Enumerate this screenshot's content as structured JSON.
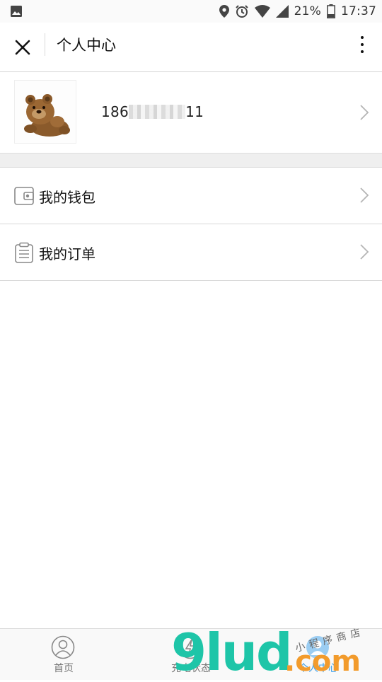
{
  "status_bar": {
    "battery": "21%",
    "time": "17:37",
    "icons": [
      "image-icon",
      "location-icon",
      "alarm-icon",
      "wifi-icon",
      "signal-icon",
      "battery-icon"
    ]
  },
  "header": {
    "title": "个人中心",
    "close_icon": "close-icon",
    "more_icon": "more-vertical-icon"
  },
  "profile": {
    "phone_prefix": "186",
    "phone_suffix": "11",
    "avatar": "teddy-bear-avatar"
  },
  "menu": [
    {
      "label": "我的钱包",
      "icon": "wallet-icon"
    },
    {
      "label": "我的订单",
      "icon": "order-clipboard-icon"
    }
  ],
  "tabbar": [
    {
      "label": "首页",
      "icon": "person-circle-icon"
    },
    {
      "label": "充电状态",
      "icon": "bolt-circle-icon"
    },
    {
      "label": "个人中心",
      "icon": "person-circle-icon",
      "active": true
    }
  ],
  "watermark": {
    "brand": "9lud",
    "domain": ".com",
    "tagline": "小程序商店"
  },
  "colors": {
    "accent": "#3a9ee8",
    "tab_inactive": "#777777",
    "divider": "#d9d9d9"
  }
}
